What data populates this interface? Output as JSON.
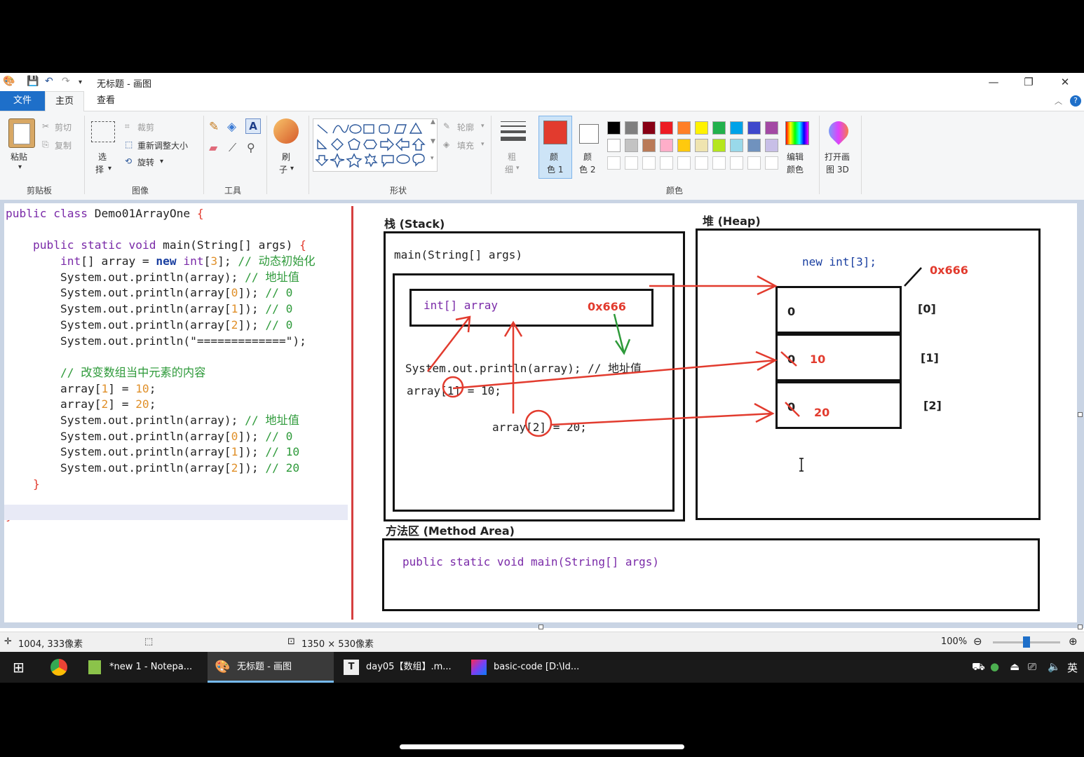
{
  "window": {
    "title": "无标题 - 画图",
    "minimize": "—",
    "restore": "❐",
    "close": "✕"
  },
  "tabs": {
    "file": "文件",
    "home": "主页",
    "view": "查看"
  },
  "ribbon": {
    "clipboard": {
      "paste": "粘贴",
      "cut": "剪切",
      "copy": "复制",
      "label": "剪贴板"
    },
    "image": {
      "select_1": "选",
      "select_2": "择",
      "crop": "裁剪",
      "resize": "重新调整大小",
      "rotate": "旋转",
      "label": "图像"
    },
    "tools": {
      "label": "工具"
    },
    "brush": {
      "l1": "刷",
      "l2": "子"
    },
    "shapes": {
      "outline": "轮廓",
      "fill": "填充",
      "label": "形状"
    },
    "size": {
      "l1": "粗",
      "l2": "细"
    },
    "color1": {
      "l1": "颜",
      "l2": "色 1",
      "value": "#e23b2e"
    },
    "color2": {
      "l1": "颜",
      "l2": "色 2",
      "value": "#ffffff"
    },
    "edit_colors": {
      "l1": "编辑",
      "l2": "颜色"
    },
    "paint3d": {
      "l1": "打开画",
      "l2": "图 3D"
    },
    "colors_label": "颜色",
    "palette_row1": [
      "#000000",
      "#7f7f7f",
      "#880015",
      "#ed1c24",
      "#ff7f27",
      "#fff200",
      "#22b14c",
      "#00a2e8",
      "#3f48cc",
      "#a349a4"
    ],
    "palette_row2": [
      "#ffffff",
      "#c3c3c3",
      "#b97a57",
      "#ffaec9",
      "#ffc90e",
      "#efe4b0",
      "#b5e61d",
      "#99d9ea",
      "#7092be",
      "#c8bfe7"
    ]
  },
  "code": {
    "lines": [
      [
        "public class Demo01ArrayOne {"
      ],
      [
        ""
      ],
      [
        "    public static void main(String[] args) {"
      ],
      [
        "        int[] array = new int[3]; // 动态初始化"
      ],
      [
        "        System.out.println(array); // 地址值"
      ],
      [
        "        System.out.println(array[0]); // 0"
      ],
      [
        "        System.out.println(array[1]); // 0"
      ],
      [
        "        System.out.println(array[2]); // 0"
      ],
      [
        "        System.out.println(\"=============\");"
      ],
      [
        ""
      ],
      [
        "        // 改变数组当中元素的内容"
      ],
      [
        "        array[1] = 10;"
      ],
      [
        "        array[2] = 20;"
      ],
      [
        "        System.out.println(array); // 地址值"
      ],
      [
        "        System.out.println(array[0]); // 0"
      ],
      [
        "        System.out.println(array[1]); // 10"
      ],
      [
        "        System.out.println(array[2]); // 20"
      ],
      [
        "    }"
      ],
      [
        ""
      ],
      [
        "}"
      ]
    ]
  },
  "diagram": {
    "stack_title": "栈 (Stack)",
    "heap_title": "堆 (Heap)",
    "method_title": "方法区 (Method Area)",
    "main_frame": "main(String[] args)",
    "array_var": "int[] array",
    "addr": "0x666",
    "println_line": "System.out.println(array); // 地址值",
    "assign1": "array[1] = 10;",
    "assign2": "array[2] = 20;",
    "new_expr": "new int[3];",
    "heap_addr": "0x666",
    "cells": [
      {
        "old": "0",
        "new": "",
        "index": "[0]"
      },
      {
        "old": "0",
        "new": "10",
        "index": "[1]"
      },
      {
        "old": "0",
        "new": "20",
        "index": "[2]"
      }
    ],
    "method_sig": "public static void main(String[] args)"
  },
  "statusbar": {
    "cursor_pos": "1004, 333像素",
    "canvas_size": "1350 × 530像素",
    "zoom": "100%",
    "zoom_level": 0.5
  },
  "taskbar": {
    "items": [
      "*new 1 - Notepa...",
      "无标题 - 画图",
      "day05【数组】.m...",
      "basic-code [D:\\Id..."
    ],
    "ime": "英"
  }
}
